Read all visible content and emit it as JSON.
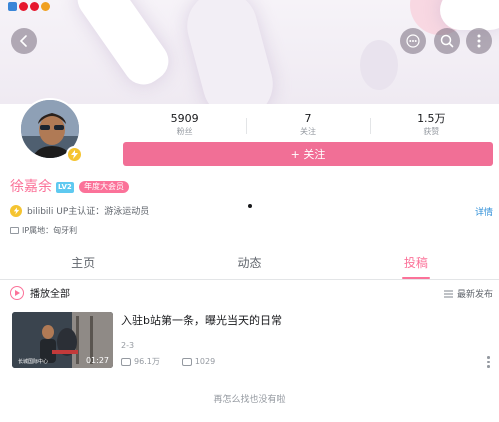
{
  "status_bar": {
    "icons": [
      {
        "name": "checkmark-app-icon",
        "color": "#3a86d8"
      },
      {
        "name": "weibo-icon",
        "color": "#e6162d"
      },
      {
        "name": "weibo-icon",
        "color": "#e6162d"
      },
      {
        "name": "weibo-icon",
        "color": "#f0a020"
      }
    ]
  },
  "header": {
    "back_icon": "back-icon",
    "actions": [
      "more-dots-icon",
      "search-icon",
      "menu-icon"
    ]
  },
  "profile": {
    "name": "徐嘉余",
    "level": "LV2",
    "vip_badge": "年度大会员",
    "stats": [
      {
        "value": "5909",
        "label": "粉丝"
      },
      {
        "value": "7",
        "label": "关注"
      },
      {
        "value": "1.5万",
        "label": "获赞"
      }
    ],
    "follow_label": "+ 关注",
    "auth_text": "bilibili UP主认证：游泳运动员",
    "detail_link": "详情",
    "ip_text": "IP属地：匈牙利"
  },
  "tabs": [
    {
      "label": "主页",
      "active": false
    },
    {
      "label": "动态",
      "active": false
    },
    {
      "label": "投稿",
      "active": true
    }
  ],
  "list_header": {
    "play_all": "播放全部",
    "sort_label": "最新发布"
  },
  "videos": [
    {
      "title": "入驻b站第一条，曝光当天的日常",
      "date": "2-3",
      "views": "96.1万",
      "comments": "1029",
      "duration": "01:27",
      "thumb_caption": "长城国际中心"
    }
  ],
  "footer": "再怎么找也没有啦",
  "colors": {
    "accent": "#fb7299",
    "follow_button": "#f16f96",
    "link": "#2f8fd8",
    "badge_yellow": "#f5c431"
  }
}
